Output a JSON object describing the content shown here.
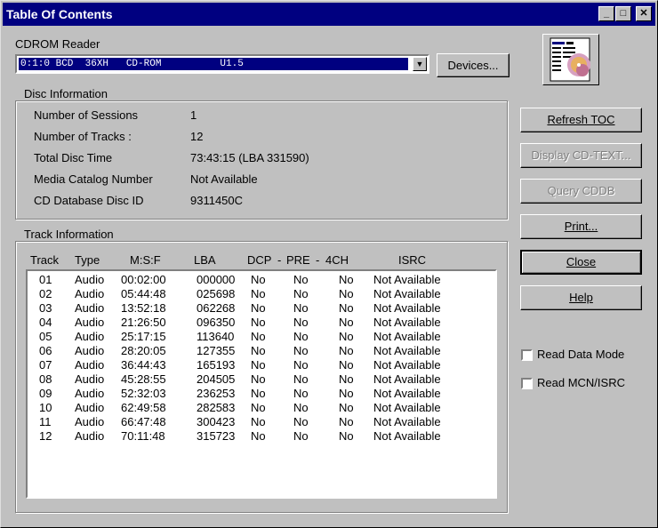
{
  "window": {
    "title": "Table Of Contents"
  },
  "titlebar_buttons": {
    "minimize": "_",
    "maximize": "□",
    "close": "✕"
  },
  "reader": {
    "label": "CDROM Reader",
    "selected": "0:1:0 BCD  36XH   CD-ROM          U1.5",
    "devices_button": "Devices..."
  },
  "disc_info": {
    "title": "Disc Information",
    "rows": [
      {
        "label": "Number of Sessions",
        "value": "1"
      },
      {
        "label": "Number of Tracks  :",
        "value": "12"
      },
      {
        "label": "Total Disc Time",
        "value": "73:43:15  (LBA 331590)"
      },
      {
        "label": "Media Catalog Number",
        "value": "Not Available"
      },
      {
        "label": "CD Database Disc ID",
        "value": "9311450C"
      }
    ]
  },
  "track_info": {
    "title": "Track Information",
    "headers": [
      "Track",
      "Type",
      "M:S:F",
      "LBA",
      "DCP",
      "-",
      "PRE",
      "-",
      "4CH",
      "ISRC"
    ],
    "rows": [
      [
        "01",
        "Audio",
        "00:02:00",
        "000000",
        "No",
        "No",
        "No",
        "Not Available"
      ],
      [
        "02",
        "Audio",
        "05:44:48",
        "025698",
        "No",
        "No",
        "No",
        "Not Available"
      ],
      [
        "03",
        "Audio",
        "13:52:18",
        "062268",
        "No",
        "No",
        "No",
        "Not Available"
      ],
      [
        "04",
        "Audio",
        "21:26:50",
        "096350",
        "No",
        "No",
        "No",
        "Not Available"
      ],
      [
        "05",
        "Audio",
        "25:17:15",
        "113640",
        "No",
        "No",
        "No",
        "Not Available"
      ],
      [
        "06",
        "Audio",
        "28:20:05",
        "127355",
        "No",
        "No",
        "No",
        "Not Available"
      ],
      [
        "07",
        "Audio",
        "36:44:43",
        "165193",
        "No",
        "No",
        "No",
        "Not Available"
      ],
      [
        "08",
        "Audio",
        "45:28:55",
        "204505",
        "No",
        "No",
        "No",
        "Not Available"
      ],
      [
        "09",
        "Audio",
        "52:32:03",
        "236253",
        "No",
        "No",
        "No",
        "Not Available"
      ],
      [
        "10",
        "Audio",
        "62:49:58",
        "282583",
        "No",
        "No",
        "No",
        "Not Available"
      ],
      [
        "11",
        "Audio",
        "66:47:48",
        "300423",
        "No",
        "No",
        "No",
        "Not Available"
      ],
      [
        "12",
        "Audio",
        "70:11:48",
        "315723",
        "No",
        "No",
        "No",
        "Not Available"
      ]
    ]
  },
  "buttons": {
    "refresh": "Refresh TOC",
    "cdtext": "Display CD-TEXT...",
    "cddb": "Query CDDB",
    "print": "Print...",
    "close": "Close",
    "help": "Help"
  },
  "checkboxes": {
    "read_data_mode": "Read Data Mode",
    "read_mcn_isrc": "Read MCN/ISRC"
  },
  "colors": {
    "titlebar": "#000080",
    "face": "#c0c0c0",
    "selection": "#000080"
  },
  "icons": {
    "app": "toc-document-icon"
  }
}
